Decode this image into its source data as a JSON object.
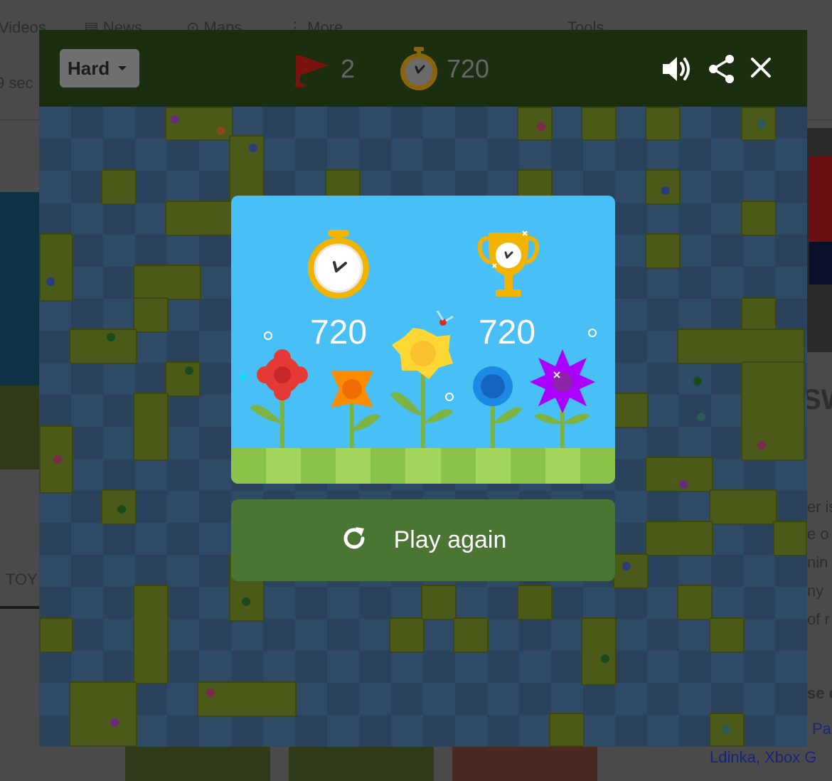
{
  "background": {
    "nav": [
      "Videos",
      "News",
      "Maps",
      "More",
      "Tools"
    ],
    "results_stub": "9 sec",
    "left_tab": "TOY",
    "right_snippets": [
      "er is",
      "e o",
      "nin",
      "ny",
      "of r"
    ],
    "right_heading": "SW",
    "right_bold": "se c",
    "right_links": [
      "Pa",
      "Ldinka, Xbox G"
    ]
  },
  "game": {
    "difficulty": "Hard",
    "flags_remaining": "2",
    "timer": "720",
    "icons": [
      "flag-icon",
      "stopwatch-icon",
      "sound-icon",
      "share-icon",
      "close-icon"
    ]
  },
  "result": {
    "time_score": "720",
    "best_score": "720",
    "play_again_label": "Play again",
    "icons": [
      "stopwatch-icon",
      "trophy-icon",
      "replay-icon"
    ]
  },
  "colors": {
    "topbar": "#1c2e10",
    "dialog_bg": "#48bff5",
    "ground_light": "#a4d65e",
    "ground_dark": "#8bc34a",
    "play_button": "#4a7532"
  }
}
